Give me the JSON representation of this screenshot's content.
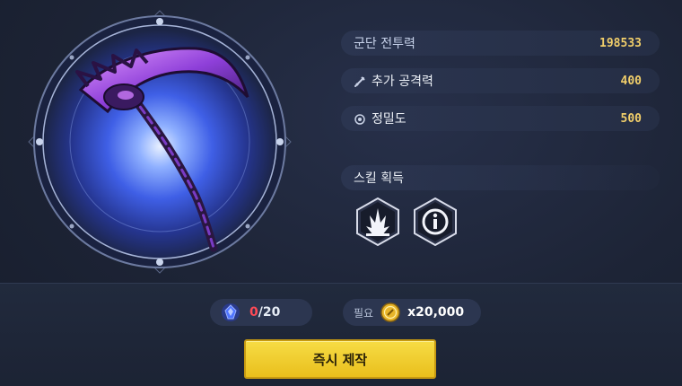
{
  "stats": {
    "power_label": "군단 전투력",
    "power_value": "198533",
    "attack_label": "추가 공격력",
    "attack_value": "400",
    "attack_icon": "sword-icon",
    "precision_label": "정밀도",
    "precision_value": "500",
    "precision_icon": "crosshair-icon"
  },
  "skills": {
    "title": "스킬 획득",
    "items": [
      {
        "icon": "burst-skill-icon"
      },
      {
        "icon": "info-skill-icon"
      }
    ]
  },
  "crafting": {
    "material_current": "0",
    "material_total": "/20",
    "material_icon": "crystal-material-icon",
    "cost_label": "필요",
    "cost_icon": "gold-coin-icon",
    "cost_value": "x20,000",
    "button_label": "즉시 제작"
  },
  "colors": {
    "accent_gold": "#f2cf6a",
    "button_yellow": "#f2cd2e",
    "count_red": "#ff4a56",
    "glow_blue": "#4a6cff"
  }
}
